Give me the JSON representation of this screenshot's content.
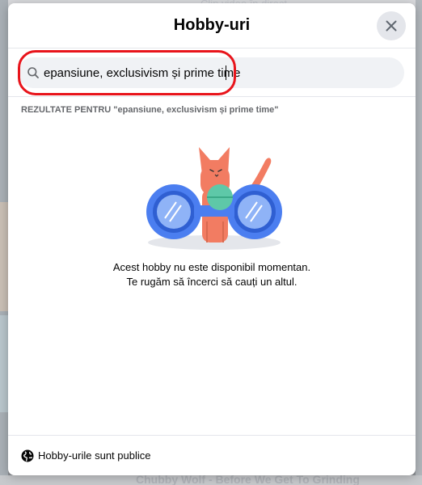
{
  "background": {
    "top_text": "Clip video în direct",
    "bottom_text": "Chubby Wolf - Before We Get To Grinding"
  },
  "modal": {
    "title": "Hobby-uri",
    "close_icon": "close-icon",
    "search": {
      "icon": "search-icon",
      "value": "epansiune, exclusivism și prime time",
      "placeholder": ""
    },
    "results_label": "REZULTATE PENTRU \"epansiune, exclusivism și prime time\"",
    "illustration": "cat-with-binoculars",
    "empty_message_line1": "Acest hobby nu este disponibil momentan.",
    "empty_message_line2": "Te rugăm să încerci să cauți un altul.",
    "footer": {
      "icon": "globe-icon",
      "text": "Hobby-urile sunt publice"
    }
  },
  "colors": {
    "accent_red": "#e8141b",
    "cat": "#f27c62",
    "binocular_blue": "#4b7ef0",
    "binocular_center": "#5ec8a8"
  }
}
